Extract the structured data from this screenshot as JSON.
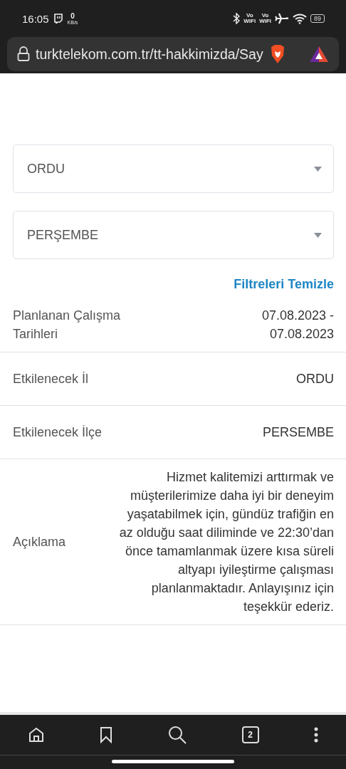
{
  "status_bar": {
    "time": "16:05",
    "speed_value": "0",
    "speed_unit": "KB/s",
    "calling": [
      {
        "top": "Vo",
        "bottom": "WiFi"
      },
      {
        "top": "Vo",
        "bottom": "WiFi"
      }
    ],
    "battery": "89"
  },
  "address_bar": {
    "url": "turktelekom.com.tr/tt-hakkimizda/Say"
  },
  "filters": [
    {
      "value": "ORDU"
    },
    {
      "value": "PERŞEMBE"
    }
  ],
  "clear_filters": "Filtreleri Temizle",
  "details": [
    {
      "label": "Planlanan Çalışma Tarihleri",
      "value": "07.08.2023 -\n07.08.2023"
    },
    {
      "label": "Etkilenecek İl",
      "value": "ORDU"
    },
    {
      "label": "Etkilenecek İlçe",
      "value": "PERSEMBE"
    },
    {
      "label": "Açıklama",
      "value": "Hizmet kalitemizi arttırmak ve müşterilerimize daha iyi bir deneyim yaşatabilmek için, gündüz trafiğin en az olduğu saat diliminde ve 22:30’dan önce tamamlanmak üzere kısa süreli altyapı iyileştirme çalışması planlanmaktadır. Anlayışınız için teşekkür ederiz."
    }
  ],
  "bottom_nav": {
    "tab_count": "2"
  }
}
